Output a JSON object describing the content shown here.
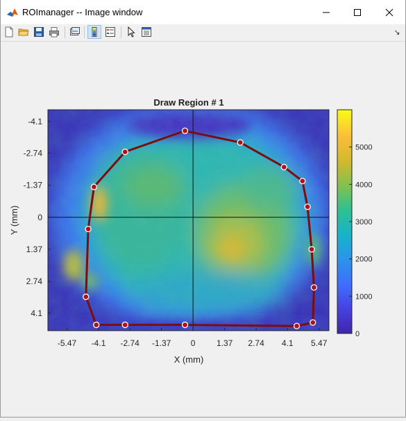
{
  "window": {
    "title": "ROImanager -- Image window",
    "minimize_label": "",
    "maximize_label": "",
    "close_label": ""
  },
  "toolbar": {
    "buttons": [
      "new-figure",
      "open-file",
      "save-figure",
      "print-figure",
      "link-plot",
      "insert-colorbar",
      "insert-legend",
      "edit-plot",
      "property-inspector"
    ],
    "dock_glyph": "↘"
  },
  "plot": {
    "title": "Draw Region # 1",
    "xlabel": "X (mm)",
    "ylabel": "Y (mm)",
    "xticks": [
      "-5.47",
      "-4.1",
      "-2.74",
      "-1.37",
      "0",
      "1.37",
      "2.74",
      "4.1",
      "5.47"
    ],
    "yticks": [
      "-4.1",
      "-2.74",
      "-1.37",
      "0",
      "1.37",
      "2.74",
      "4.1"
    ],
    "colorbar_ticks": [
      "5000",
      "4000",
      "3000",
      "2000",
      "1000",
      "0"
    ]
  },
  "colors": {
    "roi_line": "#7b0d0d",
    "vertex_fill": "#b0111a",
    "colormap": [
      "#3e26a8",
      "#4741e2",
      "#3e6ffd",
      "#2b93ec",
      "#18b3ca",
      "#2cc093",
      "#82c14f",
      "#d2b92c",
      "#fbbe3a",
      "#f9fb15"
    ]
  },
  "chart_data": {
    "type": "heatmap",
    "title": "Draw Region # 1",
    "xlabel": "X (mm)",
    "ylabel": "Y (mm)",
    "xlim": [
      -6.3,
      5.9
    ],
    "ylim": [
      -4.6,
      4.85
    ],
    "y_reversed": true,
    "colorbar": {
      "min": 0,
      "max": 6000,
      "ticks": [
        0,
        1000,
        2000,
        3000,
        4000,
        5000
      ]
    },
    "roi_polygon": [
      {
        "x": -0.35,
        "y": -3.7
      },
      {
        "x": 2.05,
        "y": -3.2
      },
      {
        "x": 3.95,
        "y": -2.15
      },
      {
        "x": 4.75,
        "y": -1.55
      },
      {
        "x": 4.97,
        "y": -0.45
      },
      {
        "x": 5.15,
        "y": 1.37
      },
      {
        "x": 5.25,
        "y": 3.0
      },
      {
        "x": 5.2,
        "y": 4.5
      },
      {
        "x": 4.5,
        "y": 4.65
      },
      {
        "x": -0.35,
        "y": 4.6
      },
      {
        "x": -2.95,
        "y": 4.6
      },
      {
        "x": -4.2,
        "y": 4.6
      },
      {
        "x": -4.65,
        "y": 3.4
      },
      {
        "x": -4.55,
        "y": 0.5
      },
      {
        "x": -4.3,
        "y": -1.3
      },
      {
        "x": -2.95,
        "y": -2.8
      }
    ],
    "crosshair": {
      "x": 0,
      "y": 0
    }
  }
}
